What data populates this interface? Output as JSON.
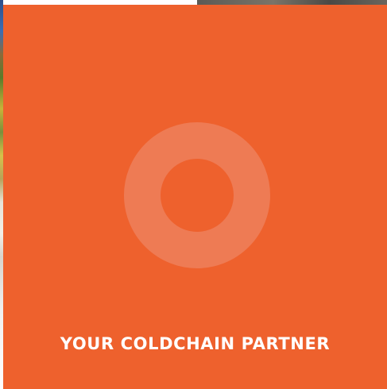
{
  "tile": {
    "tagline": "YOUR COLDCHAIN PARTNER",
    "accent_color": "#ee612d",
    "ring_color": "#ee7b54",
    "icon": "ring-logo-icon"
  }
}
